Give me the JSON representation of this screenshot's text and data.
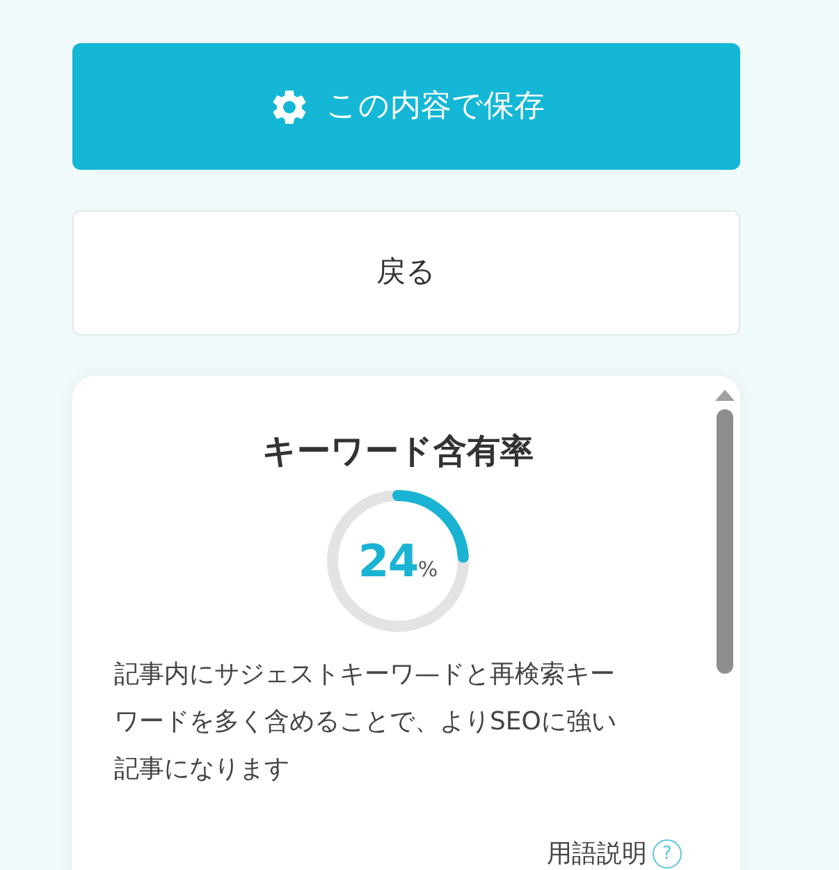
{
  "save_button": {
    "label": "この内容で保存"
  },
  "back_button": {
    "label": "戻る"
  },
  "card": {
    "title": "キーワード含有率",
    "gauge": {
      "value": "24",
      "unit": "%"
    },
    "description": "記事内にサジェストキーワ—ドと再検索キーワードを多く含めることで、よりSEOに強い記事になります",
    "help_link": {
      "label": "用語説明",
      "icon": "?"
    }
  }
}
